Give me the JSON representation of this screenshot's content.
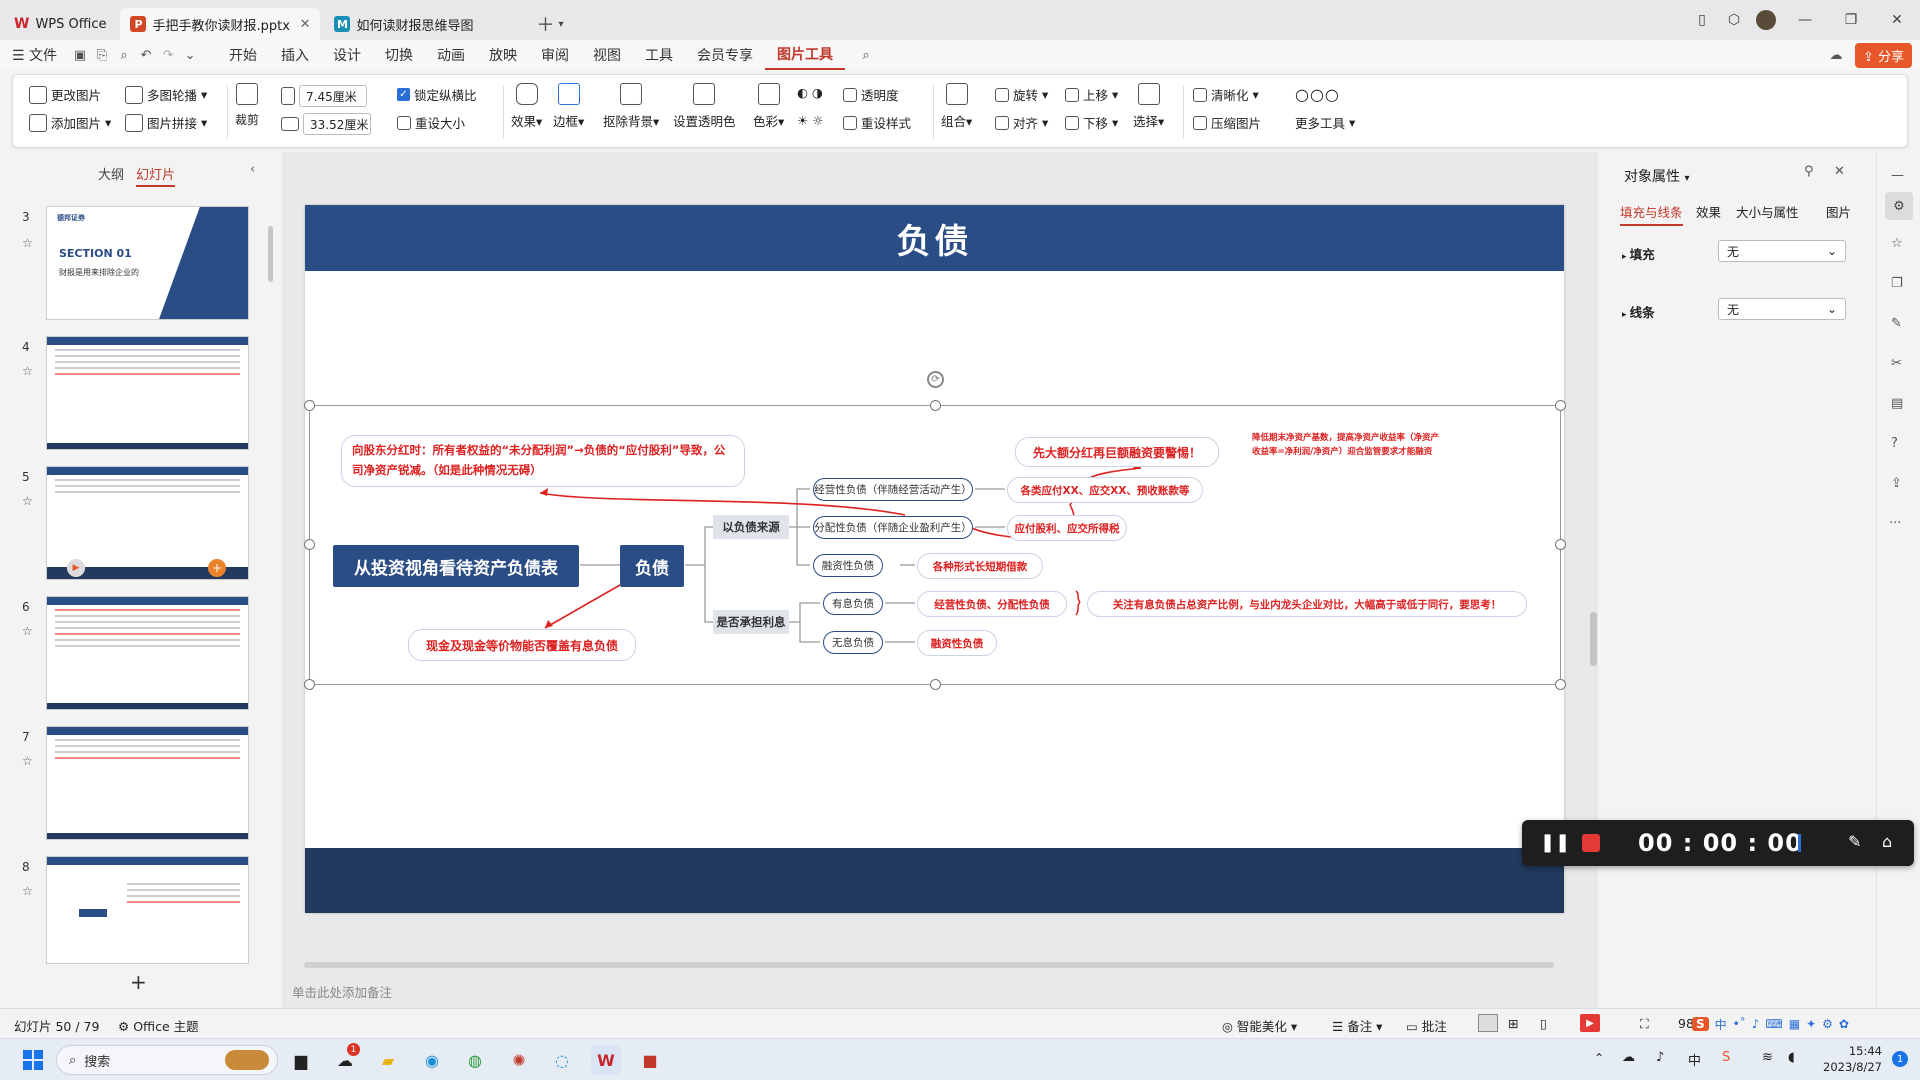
{
  "tabs": [
    {
      "label": "WPS Office",
      "icon": "wps-logo-icon",
      "color": "#c9252c"
    },
    {
      "label": "手把手教你读财报.pptx",
      "icon": "pptx-icon",
      "color": "#d24726"
    },
    {
      "label": "如何读财报思维导图",
      "icon": "mindmap-icon",
      "color": "#1a8fb5"
    }
  ],
  "menu": {
    "file": "文件",
    "items": [
      "开始",
      "插入",
      "设计",
      "切换",
      "动画",
      "放映",
      "审阅",
      "视图",
      "工具",
      "会员专享",
      "图片工具"
    ],
    "active": "图片工具",
    "share": "分享"
  },
  "ribbon": {
    "change_pic": "更改图片",
    "add_pic": "添加图片",
    "multi_carousel": "多图轮播",
    "pic_stitch": "图片拼接",
    "crop": "裁剪",
    "width": "7.45厘米",
    "height": "33.52厘米",
    "lock_ratio": "锁定纵横比",
    "reset_size": "重设大小",
    "effects": "效果",
    "border": "边框",
    "cutout": "抠除背景",
    "set_transparent": "设置透明色",
    "color": "色彩",
    "transparency": "透明度",
    "reset_style": "重设样式",
    "group": "组合",
    "rotate": "旋转",
    "align": "对齐",
    "bring_forward": "上移",
    "send_backward": "下移",
    "select": "选择",
    "clarify": "清晰化",
    "compress": "压缩图片",
    "more_tools": "更多工具"
  },
  "left": {
    "outline": "大纲",
    "slides": "幻灯片",
    "slide_numbers": [
      "3",
      "4",
      "5",
      "6",
      "7",
      "8"
    ],
    "thumb3_title": "SECTION 01",
    "thumb3_sub": "财报是用来排除企业的",
    "thumb3_brand": "德邦证券"
  },
  "slide": {
    "title": "负债",
    "root": "从投资视角看待资产负债表",
    "center": "负债",
    "branch1": "以负债来源",
    "branch2": "是否承担利息",
    "b1_items": [
      "经营性负债（伴随经营活动产生）",
      "分配性负债（伴随企业盈利产生）",
      "融资性负债"
    ],
    "b1_notes": [
      "各类应付XX、应交XX、预收账款等",
      "应付股利、应交所得税",
      "各种形式长短期借款"
    ],
    "b2_items": [
      "有息负债",
      "无息负债"
    ],
    "b2_notes": [
      "经营性负债、分配性负债",
      "融资性负债"
    ],
    "note_top_left": "向股东分红时：所有者权益的“未分配利润”→负债的“应付股利”导致，公司净资产锐减。（如是此种情况无碍）",
    "note_top_right": "先大额分红再巨额融资要警惕！",
    "note_far_right": "降低期末净资产基数，提高净资产收益率（净资产收益率=净利润/净资产）迎合监管要求才能融资",
    "note_bottom_right": "关注有息负债占总资产比例，与业内龙头企业对比，大幅高于或低于同行，要思考！",
    "note_bottom_left": "现金及现金等价物能否覆盖有息负债"
  },
  "notes_placeholder": "单击此处添加备注",
  "right": {
    "title": "对象属性",
    "tabs": [
      "填充与线条",
      "效果",
      "大小与属性",
      "图片"
    ],
    "fill_label": "填充",
    "fill_value": "无",
    "line_label": "线条",
    "line_value": "无"
  },
  "status": {
    "slide_info": "幻灯片 50 / 79",
    "theme": "Office 主题",
    "beautify": "智能美化",
    "notes": "备注",
    "comment": "批注",
    "zoom": "98"
  },
  "recorder": {
    "time": "00 : 00 : 00"
  },
  "taskbar": {
    "search": "搜索",
    "time": "15:44",
    "date": "2023/8/27",
    "ime": "中",
    "notif": "1",
    "badge": "1"
  }
}
